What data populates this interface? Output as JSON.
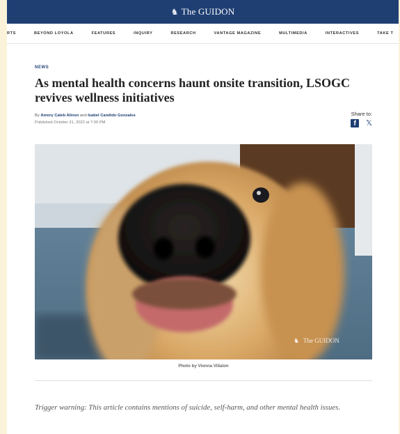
{
  "masthead": {
    "logo_text": "The GUIDON",
    "logo_mark": "♞"
  },
  "nav": {
    "items": [
      "RTS",
      "BEYOND LOYOLA",
      "FEATURES",
      "INQUIRY",
      "RESEARCH",
      "VANTAGE MAGAZINE",
      "MULTIMEDIA",
      "INTERACTIVES",
      "TAKE T"
    ]
  },
  "article": {
    "section": "NEWS",
    "headline": "As mental health concerns haunt onsite transition, LSOGC revives wellness initiatives",
    "byline_prefix": "By",
    "author_1": "Amory Caleb Alinsn",
    "byline_and": "and",
    "author_2": "Isabel Candido Gonzales",
    "published": "Published October 31, 2022 at 7:00 PM",
    "share_label": "Share to:",
    "photo_watermark": "The GUIDON",
    "caption": "Photo by Vionna Villalon",
    "trigger_warning": "Trigger warning: This article contains mentions of suicide, self-harm, and other mental health issues."
  },
  "icons": {
    "facebook": "facebook-icon",
    "x": "x-icon"
  },
  "colors": {
    "brand_navy": "#1f3f73",
    "page_background": "#fbf3d9"
  }
}
